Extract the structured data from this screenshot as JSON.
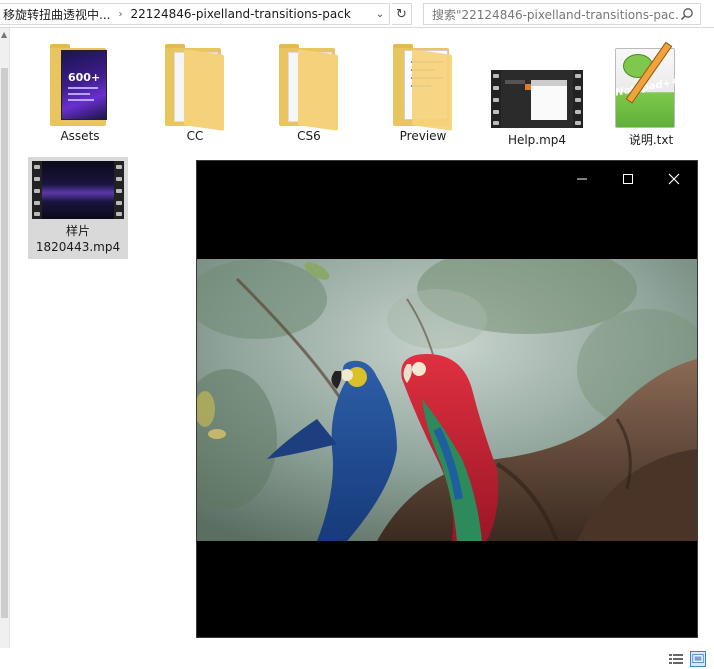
{
  "window": {
    "breadcrumb": [
      "移旋转扭曲透视中...",
      "22124846-pixelland-transitions-pack"
    ],
    "search_placeholder": "搜索\"22124846-pixelland-transitions-pac...",
    "items": [
      {
        "label": "Assets",
        "type": "folder-poster"
      },
      {
        "label": "CC",
        "type": "folder"
      },
      {
        "label": "CS6",
        "type": "folder"
      },
      {
        "label": "Preview",
        "type": "folder-docs"
      },
      {
        "label": "Help.mp4",
        "type": "video"
      },
      {
        "label": "说明.txt",
        "type": "notepad"
      }
    ],
    "selected_item": {
      "label_line1": "样片",
      "label_line2": "1820443.mp4"
    },
    "poster_text": "600+"
  },
  "player": {
    "minimize_glyph": "—",
    "maximize_glyph": "☐",
    "close_glyph": "✕"
  },
  "colors": {
    "folder_yellow": "#f5d27a",
    "selection": "#d9d9d9",
    "player_bg": "#000000"
  }
}
